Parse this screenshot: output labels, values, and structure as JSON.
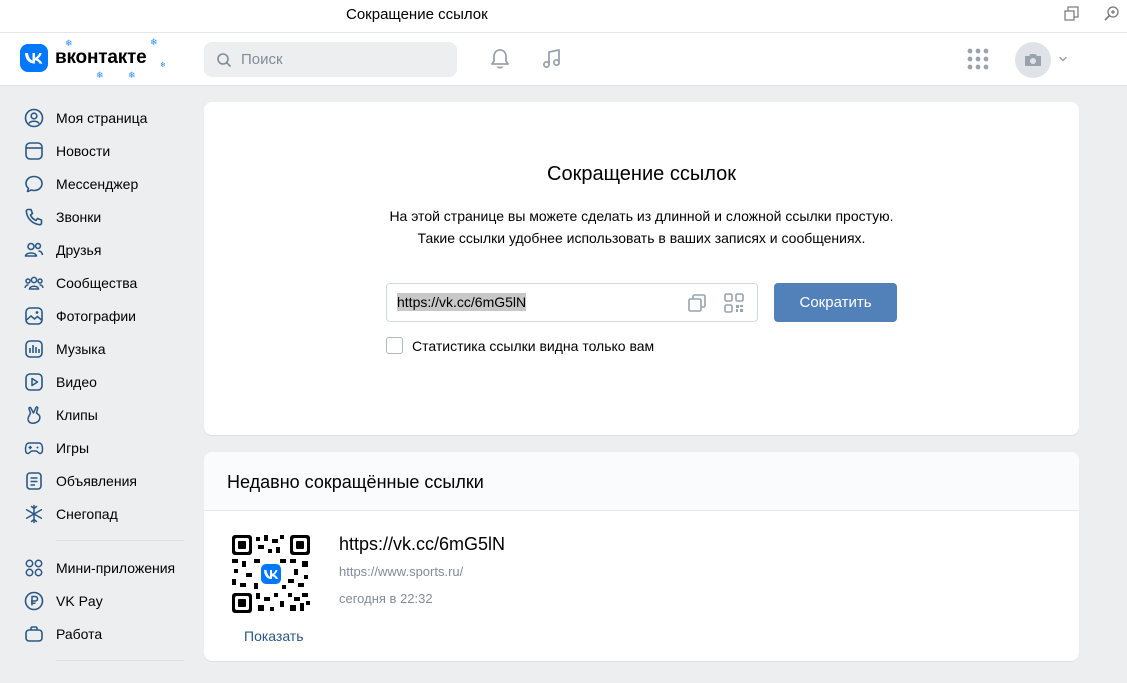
{
  "window": {
    "title": "Сокращение ссылок"
  },
  "header": {
    "logo_text": "вконтакте",
    "search_placeholder": "Поиск"
  },
  "sidebar": {
    "items": [
      {
        "label": "Моя страница",
        "icon": "user-circle-icon"
      },
      {
        "label": "Новости",
        "icon": "news-icon"
      },
      {
        "label": "Мессенджер",
        "icon": "message-icon"
      },
      {
        "label": "Звонки",
        "icon": "phone-icon"
      },
      {
        "label": "Друзья",
        "icon": "friends-icon"
      },
      {
        "label": "Сообщества",
        "icon": "communities-icon"
      },
      {
        "label": "Фотографии",
        "icon": "photo-icon"
      },
      {
        "label": "Музыка",
        "icon": "music-icon"
      },
      {
        "label": "Видео",
        "icon": "video-icon"
      },
      {
        "label": "Клипы",
        "icon": "clips-icon"
      },
      {
        "label": "Игры",
        "icon": "gamepad-icon"
      },
      {
        "label": "Объявления",
        "icon": "classifieds-icon"
      },
      {
        "label": "Снегопад",
        "icon": "snowflake-icon"
      }
    ],
    "items2": [
      {
        "label": "Мини-приложения",
        "icon": "apps-icon"
      },
      {
        "label": "VK Pay",
        "icon": "vkpay-icon"
      },
      {
        "label": "Работа",
        "icon": "briefcase-icon"
      }
    ]
  },
  "shortener": {
    "title": "Сокращение ссылок",
    "desc_line1": "На этой странице вы можете сделать из длинной и сложной ссылки простую.",
    "desc_line2": "Такие ссылки удобнее использовать в ваших записях и сообщениях.",
    "url_value": "https://vk.cc/6mG5lN",
    "button_label": "Сократить",
    "checkbox_label": "Статистика ссылки видна только вам"
  },
  "recent": {
    "title": "Недавно сокращённые ссылки",
    "items": [
      {
        "short_url": "https://vk.cc/6mG5lN",
        "original_url": "https://www.sports.ru/",
        "time": "сегодня в 22:32",
        "show_label": "Показать"
      }
    ]
  },
  "colors": {
    "accent": "#5181b8",
    "brand": "#0077ff",
    "link": "#2a5885",
    "muted": "#818c99"
  }
}
